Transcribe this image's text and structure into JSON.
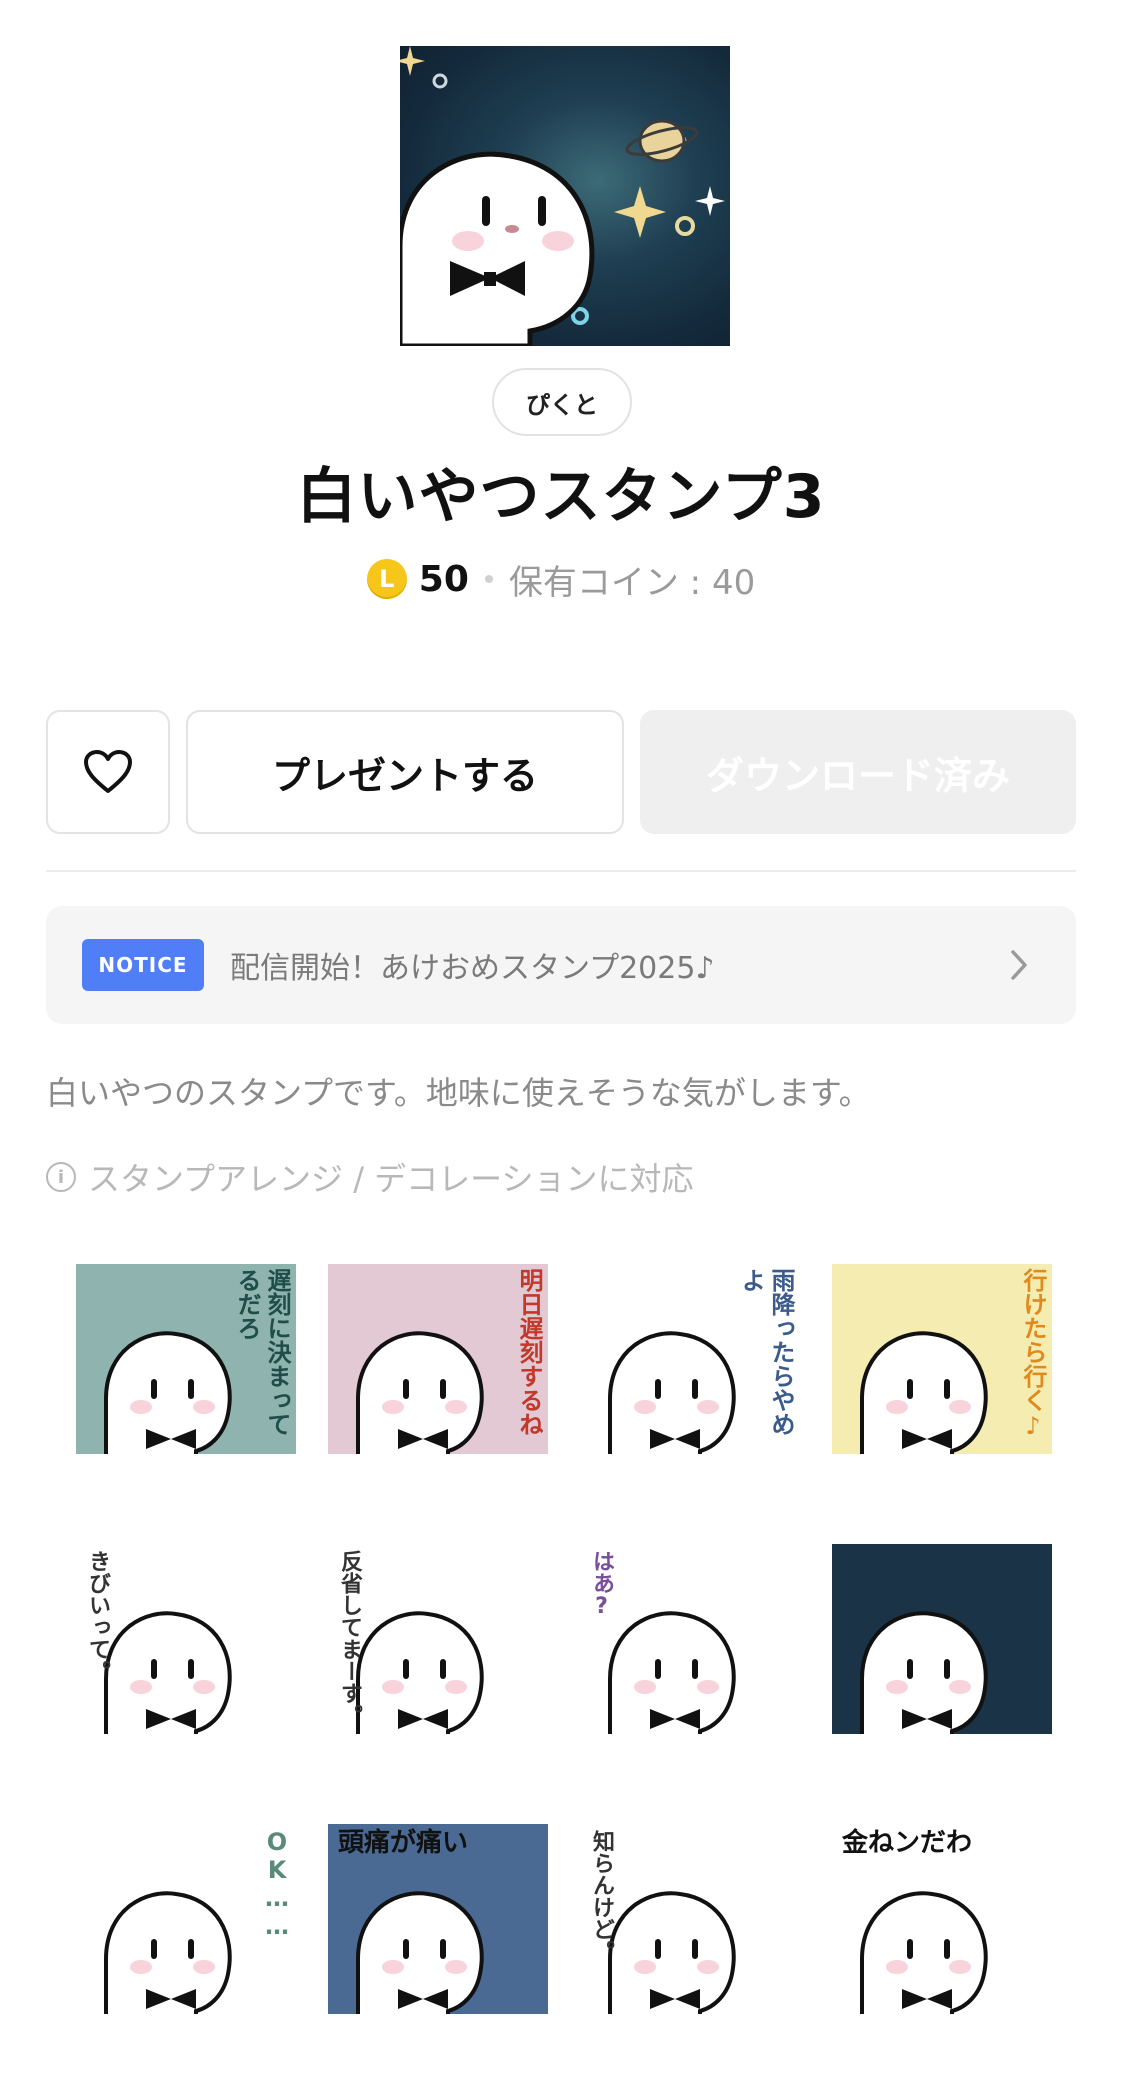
{
  "product": {
    "author": "ぴくと",
    "title": "白いやつスタンプ3",
    "coin_letter": "L",
    "price": "50",
    "owned_coins": "保有コイン : 40"
  },
  "actions": {
    "gift_label": "プレゼントする",
    "download_label": "ダウンロード済み"
  },
  "notice": {
    "badge": "NOTICE",
    "text": "配信開始！あけおめスタンプ2025♪"
  },
  "description": "白いやつのスタンプです。地味に使えそうな気がします。",
  "arrange_note": "スタンプアレンジ / デコレーションに対応",
  "info_glyph": "i",
  "stickers": [
    {
      "text": "遅刻に決まってるだろ",
      "bg": "#8fb3ae",
      "color": "#1f4d4a"
    },
    {
      "text": "明日遅刻するね",
      "bg": "#e3c9d4",
      "color": "#c0392b"
    },
    {
      "text": "雨降ったらやめよ",
      "bg": "#ffffff",
      "color": "#3b5b8c"
    },
    {
      "text": "行けたら行く♪",
      "bg": "#f4ecb0",
      "color": "#e08a1e"
    },
    {
      "text": "きびいって。",
      "bg": "#ffffff",
      "color": "#333333"
    },
    {
      "text": "反省してまーす。",
      "bg": "#ffffff",
      "color": "#333333"
    },
    {
      "text": "はあ?",
      "bg": "#ffffff",
      "color": "#7a4f9a"
    },
    {
      "text": "",
      "bg": "#1a3346",
      "color": "#ffffff"
    },
    {
      "text": "OK……",
      "bg": "#ffffff",
      "color": "#5a8a78"
    },
    {
      "text": "頭痛が痛い",
      "bg": "#4a6a94",
      "color": "#111111"
    },
    {
      "text": "知らんけど。",
      "bg": "#ffffff",
      "color": "#333333"
    },
    {
      "text": "金ねンだわ",
      "bg": "#ffffff",
      "color": "#111111"
    }
  ]
}
